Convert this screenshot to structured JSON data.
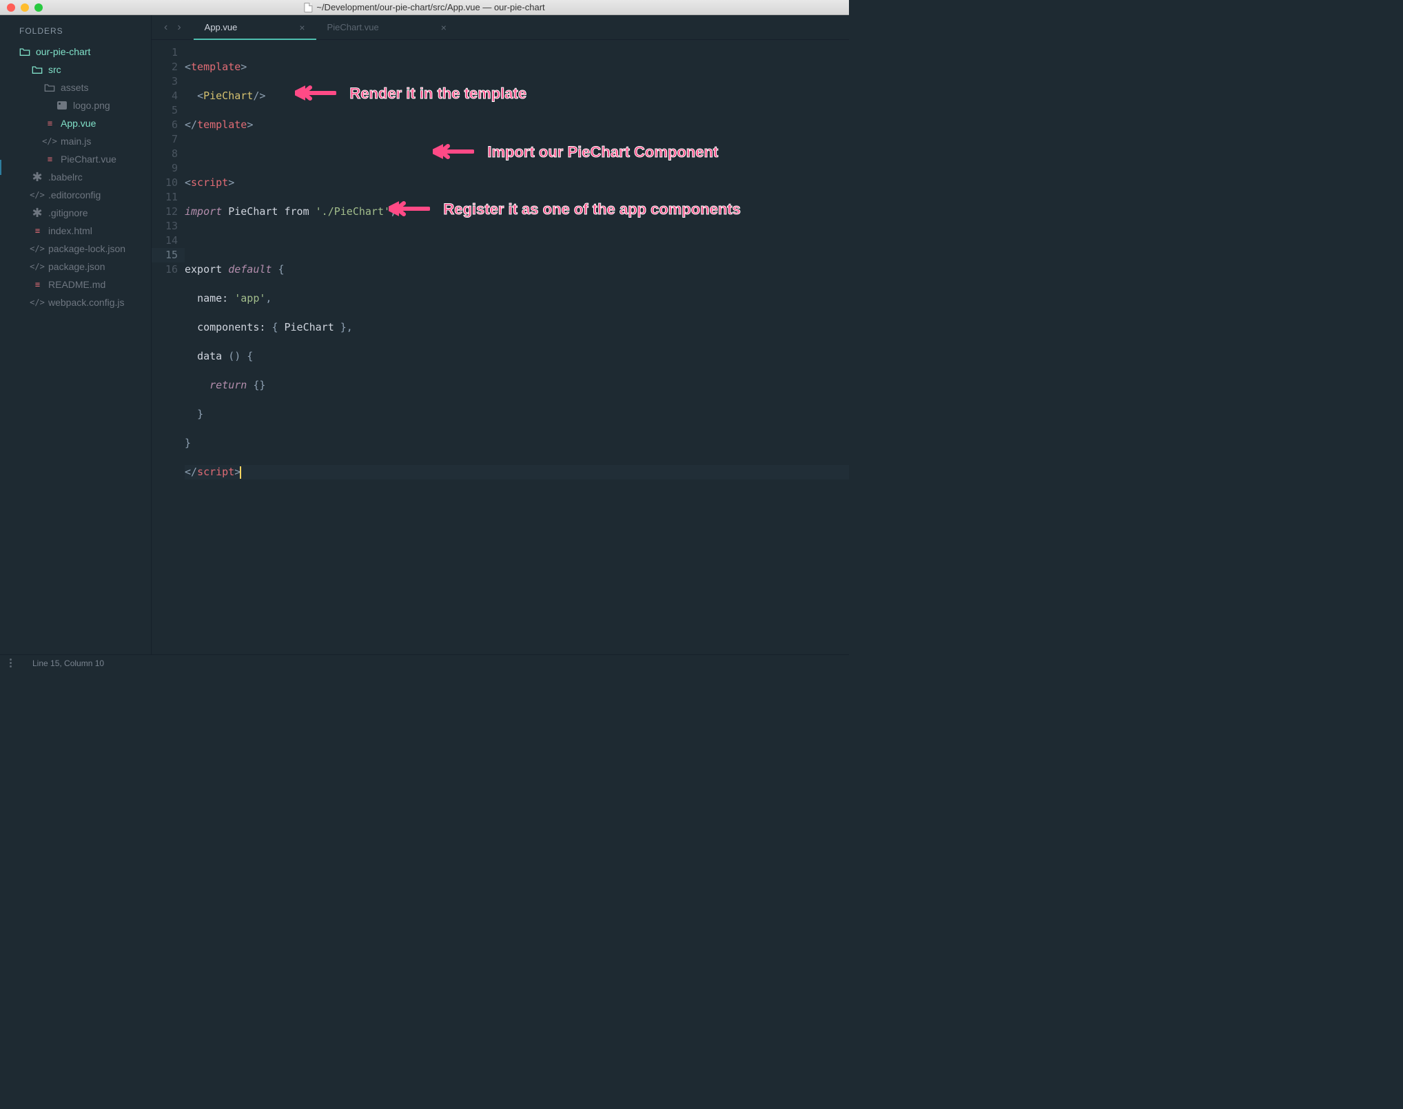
{
  "window": {
    "title": "~/Development/our-pie-chart/src/App.vue — our-pie-chart"
  },
  "sidebar": {
    "header": "FOLDERS",
    "items": [
      {
        "label": "our-pie-chart",
        "type": "folder-open",
        "indent": 0,
        "active": false,
        "teal": true
      },
      {
        "label": "src",
        "type": "folder-open",
        "indent": 1,
        "teal": true
      },
      {
        "label": "assets",
        "type": "folder-open",
        "indent": 2,
        "dim": true
      },
      {
        "label": "logo.png",
        "type": "image",
        "indent": 3,
        "dim": true
      },
      {
        "label": "App.vue",
        "type": "vue",
        "indent": 2,
        "active": true
      },
      {
        "label": "main.js",
        "type": "code",
        "indent": 2,
        "dim": true
      },
      {
        "label": "PieChart.vue",
        "type": "vue-dim",
        "indent": 2,
        "dim": true
      },
      {
        "label": ".babelrc",
        "type": "asterisk",
        "indent": 1,
        "dim": true
      },
      {
        "label": ".editorconfig",
        "type": "code",
        "indent": 1,
        "dim": true
      },
      {
        "label": ".gitignore",
        "type": "asterisk",
        "indent": 1,
        "dim": true
      },
      {
        "label": "index.html",
        "type": "html",
        "indent": 1,
        "dim": true
      },
      {
        "label": "package-lock.json",
        "type": "code",
        "indent": 1,
        "dim": true
      },
      {
        "label": "package.json",
        "type": "code",
        "indent": 1,
        "dim": true
      },
      {
        "label": "README.md",
        "type": "html",
        "indent": 1,
        "dim": true
      },
      {
        "label": "webpack.config.js",
        "type": "code",
        "indent": 1,
        "dim": true
      }
    ]
  },
  "tabs": [
    {
      "label": "App.vue",
      "active": true
    },
    {
      "label": "PieChart.vue",
      "active": false
    }
  ],
  "code": {
    "lines": [
      "<template>",
      "  <PieChart/>",
      "</template>",
      "",
      "<script>",
      "import PieChart from './PieChart';",
      "",
      "export default {",
      "  name: 'app',",
      "  components: { PieChart },",
      "  data () {",
      "    return {}",
      "  }",
      "}",
      "</script>",
      ""
    ],
    "current_line": 15
  },
  "annotations": [
    {
      "text": "Render it in the template"
    },
    {
      "text": "Import our PieChart Component"
    },
    {
      "text": "Register it as one of the app components"
    }
  ],
  "status": {
    "position": "Line 15, Column 10"
  }
}
